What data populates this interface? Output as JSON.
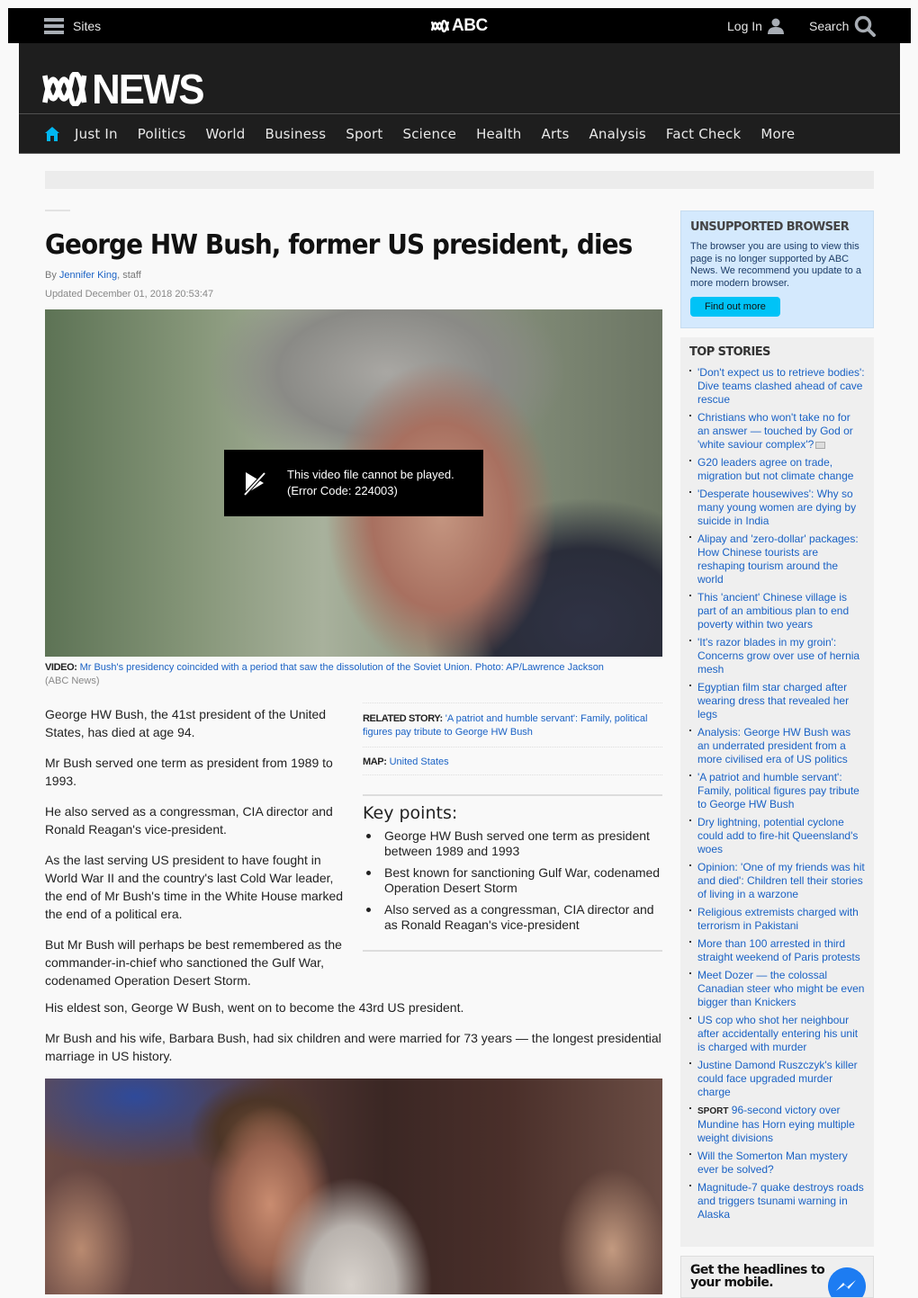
{
  "topbar": {
    "sites_label": "Sites",
    "brand": "ABC",
    "login_label": "Log In",
    "search_label": "Search"
  },
  "masthead": {
    "logo_text": "NEWS",
    "nav": [
      "Just In",
      "Politics",
      "World",
      "Business",
      "Sport",
      "Science",
      "Health",
      "Arts",
      "Analysis",
      "Fact Check",
      "More"
    ],
    "accent_color": "#00b7f1"
  },
  "article": {
    "title": "George HW Bush, former US president, dies",
    "byline_prefix": "By",
    "author": "Jennifer King",
    "byline_suffix": ", staff",
    "updated": "Updated December 01, 2018 20:53:47",
    "video_error_line1": "This video file cannot be played.",
    "video_error_line2": "(Error Code: 224003)",
    "caption_label": "VIDEO:",
    "caption_text": "Mr Bush's presidency coincided with a period that saw the dissolution of the Soviet Union. Photo: AP/Lawrence Jackson",
    "caption_source": "(ABC News)",
    "paragraphs_left": [
      "George HW Bush, the 41st president of the United States, has died at age 94.",
      "Mr Bush served one term as president from 1989 to 1993.",
      "He also served as a congressman, CIA director and Ronald Reagan's vice-president.",
      "As the last serving US president to have fought in World War II and the country's last Cold War leader, the end of Mr Bush's time in the White House marked the end of a political era.",
      "But Mr Bush will perhaps be best remembered as the commander-in-chief who sanctioned the Gulf War, codenamed Operation Desert Storm."
    ],
    "paragraphs_full": [
      "His eldest son, George W Bush, went on to become the 43rd US president.",
      "Mr Bush and his wife, Barbara Bush, had six children and were married for 73 years — the longest presidential marriage in US history."
    ],
    "related_label": "RELATED STORY:",
    "related_text": "'A patriot and humble servant': Family, political figures pay tribute to George HW Bush",
    "map_label": "MAP:",
    "map_text": "United States",
    "key_points_title": "Key points:",
    "key_points": [
      "George HW Bush served one term as president between 1989 and 1993",
      "Best known for sanctioning Gulf War, codenamed Operation Desert Storm",
      "Also served as a congressman, CIA director and as Ronald Reagan's vice-president"
    ]
  },
  "sidebar": {
    "unsupported_title": "UNSUPPORTED BROWSER",
    "unsupported_text": "The browser you are using to view this page is no longer supported by ABC News. We recommend you update to a more modern browser.",
    "unsupported_button": "Find out more",
    "top_stories_title": "TOP STORIES",
    "top_stories": [
      {
        "tag": "",
        "text": "'Don't expect us to retrieve bodies': Dive teams clashed ahead of cave rescue"
      },
      {
        "tag": "",
        "text": "Christians who won't take no for an answer — touched by God or 'white saviour complex'?",
        "media": true
      },
      {
        "tag": "",
        "text": "G20 leaders agree on trade, migration but not climate change"
      },
      {
        "tag": "",
        "text": "'Desperate housewives': Why so many young women are dying by suicide in India"
      },
      {
        "tag": "",
        "text": "Alipay and 'zero-dollar' packages: How Chinese tourists are reshaping tourism around the world"
      },
      {
        "tag": "",
        "text": "This 'ancient' Chinese village is part of an ambitious plan to end poverty within two years"
      },
      {
        "tag": "",
        "text": "'It's razor blades in my groin': Concerns grow over use of hernia mesh"
      },
      {
        "tag": "",
        "text": "Egyptian film star charged after wearing dress that revealed her legs"
      },
      {
        "tag": "",
        "text": "Analysis: George HW Bush was an underrated president from a more civilised era of US politics"
      },
      {
        "tag": "",
        "text": "'A patriot and humble servant': Family, political figures pay tribute to George HW Bush"
      },
      {
        "tag": "",
        "text": "Dry lightning, potential cyclone could add to fire-hit Queensland's woes"
      },
      {
        "tag": "",
        "text": "Opinion: 'One of my friends was hit and died': Children tell their stories of living in a warzone"
      },
      {
        "tag": "",
        "text": "Religious extremists charged with terrorism in Pakistani"
      },
      {
        "tag": "",
        "text": "More than 100 arrested in third straight weekend of Paris protests"
      },
      {
        "tag": "",
        "text": "Meet Dozer — the colossal Canadian steer who might be even bigger than Knickers"
      },
      {
        "tag": "",
        "text": "US cop who shot her neighbour after accidentally entering his unit is charged with murder"
      },
      {
        "tag": "",
        "text": "Justine Damond Ruszczyk's killer could face upgraded murder charge"
      },
      {
        "tag": "SPORT",
        "text": "96-second victory over Mundine has Horn eying multiple weight divisions"
      },
      {
        "tag": "",
        "text": "Will the Somerton Man mystery ever be solved?"
      },
      {
        "tag": "",
        "text": "Magnitude-7 quake destroys roads and triggers tsunami warning in Alaska"
      }
    ],
    "mobile_promo": "Get the headlines to your mobile."
  }
}
